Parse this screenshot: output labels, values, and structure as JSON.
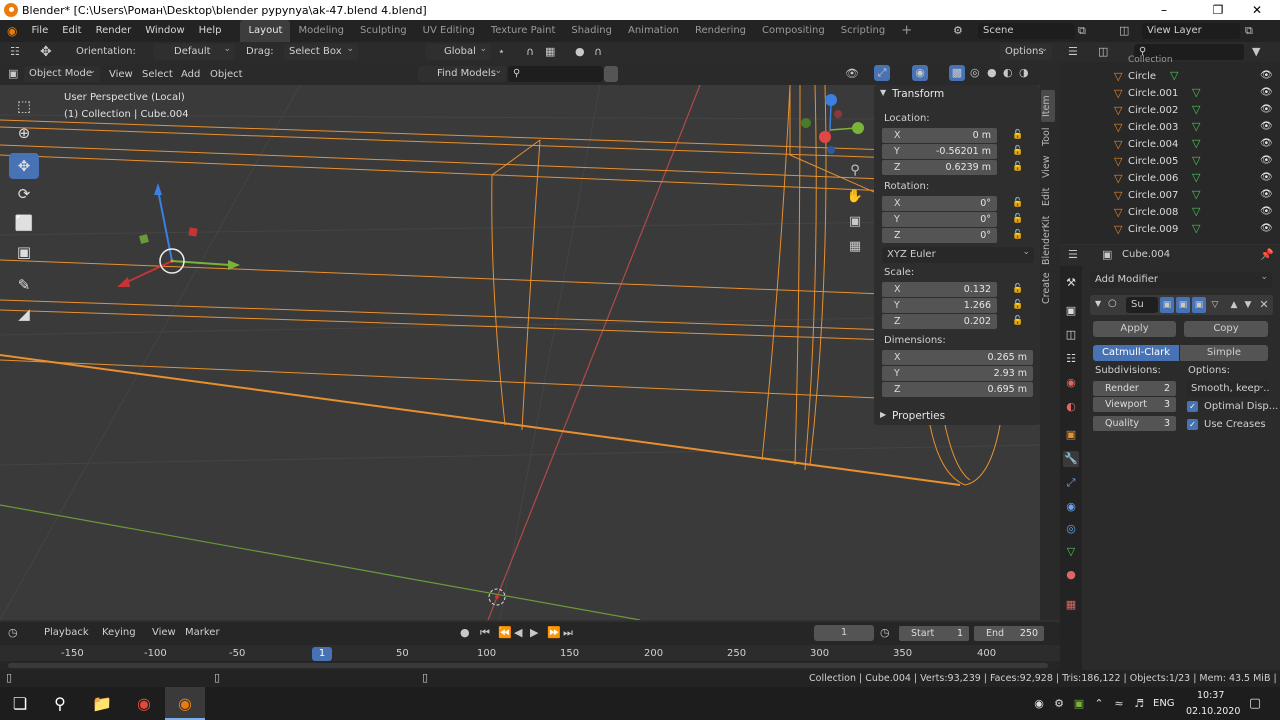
{
  "window": {
    "title": "Blender* [C:\\Users\\Роман\\Desktop\\blender руруnya\\ak-47.blend 4.blend]"
  },
  "menu": {
    "items": [
      "File",
      "Edit",
      "Render",
      "Window",
      "Help"
    ]
  },
  "workspaces": [
    "Layout",
    "Modeling",
    "Sculpting",
    "UV Editing",
    "Texture Paint",
    "Shading",
    "Animation",
    "Rendering",
    "Compositing",
    "Scripting"
  ],
  "active_workspace": "Layout",
  "scene": {
    "name": "Scene",
    "view_layer": "View Layer"
  },
  "tool_header": {
    "orientation_label": "Orientation:",
    "orientation_value": "Default",
    "drag_label": "Drag:",
    "drag_value": "Select Box",
    "transform_orientation": "Global",
    "options": "Options"
  },
  "viewport_header": {
    "mode": "Object Mode",
    "view": "View",
    "select": "Select",
    "add": "Add",
    "object": "Object",
    "find_models": "Find Models"
  },
  "viewport": {
    "perspective": "User Perspective (Local)",
    "collection_info": "(1) Collection | Cube.004"
  },
  "npanel": {
    "transform_title": "Transform",
    "location_label": "Location:",
    "location": {
      "x": "0 m",
      "y": "-0.56201 m",
      "z": "0.6239 m"
    },
    "rotation_label": "Rotation:",
    "rotation": {
      "x": "0°",
      "y": "0°",
      "z": "0°"
    },
    "rotation_mode": "XYZ Euler",
    "scale_label": "Scale:",
    "scale": {
      "x": "0.132",
      "y": "1.266",
      "z": "0.202"
    },
    "dimensions_label": "Dimensions:",
    "dimensions": {
      "x": "0.265 m",
      "y": "2.93 m",
      "z": "0.695 m"
    },
    "properties_title": "Properties",
    "axis_x": "X",
    "axis_y": "Y",
    "axis_z": "Z",
    "tabs": [
      "Item",
      "Tool",
      "View",
      "Edit",
      "BlenderKit",
      "Create"
    ]
  },
  "outliner": {
    "partial_top": "Collection",
    "items": [
      "Circle",
      "Circle.001",
      "Circle.002",
      "Circle.003",
      "Circle.004",
      "Circle.005",
      "Circle.006",
      "Circle.007",
      "Circle.008",
      "Circle.009"
    ]
  },
  "properties": {
    "object_name": "Cube.004",
    "add_modifier": "Add Modifier",
    "modifier_name": "Su",
    "apply": "Apply",
    "copy": "Copy",
    "type_catmull": "Catmull-Clark",
    "type_simple": "Simple",
    "subdivisions_label": "Subdivisions:",
    "options_label": "Options:",
    "render_label": "Render",
    "render_value": "2",
    "viewport_label": "Viewport",
    "viewport_value": "3",
    "quality_label": "Quality",
    "quality_value": "3",
    "uv_smooth": "Smooth, keep ...",
    "optimal_display": "Optimal Disp...",
    "use_creases": "Use Creases"
  },
  "timeline": {
    "playback": "Playback",
    "keying": "Keying",
    "view": "View",
    "marker": "Marker",
    "current_frame": "1",
    "start_label": "Start",
    "start_value": "1",
    "end_label": "End",
    "end_value": "250",
    "ruler": [
      "-150",
      "-100",
      "-50",
      "1",
      "50",
      "100",
      "150",
      "200",
      "250",
      "300",
      "350",
      "400"
    ]
  },
  "status": {
    "text": "Collection | Cube.004 | Verts:93,239 | Faces:92,928 | Tris:186,122 | Objects:1/23 | Mem: 43.5 MiB | 2.83.4"
  },
  "taskbar": {
    "lang": "ENG",
    "time": "10:37",
    "date": "02.10.2020"
  },
  "colors": {
    "accent": "#4772b3",
    "selection_orange": "#e8902e",
    "mesh_green": "#4fc35e"
  }
}
